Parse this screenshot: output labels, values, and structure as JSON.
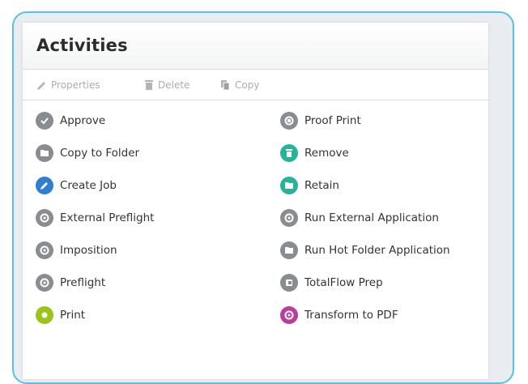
{
  "panel": {
    "title": "Activities"
  },
  "toolbar": {
    "properties_label": "Properties",
    "delete_label": "Delete",
    "copy_label": "Copy"
  },
  "activities": {
    "left": [
      {
        "label": "Approve",
        "icon": "checkmark-icon",
        "color": "#8a8d90"
      },
      {
        "label": "Copy to Folder",
        "icon": "folder-icon",
        "color": "#8a8d90"
      },
      {
        "label": "Create Job",
        "icon": "pencil-icon",
        "color": "#2f7fd0"
      },
      {
        "label": "External Preflight",
        "icon": "gear-icon",
        "color": "#8a8d90"
      },
      {
        "label": "Imposition",
        "icon": "gear-icon",
        "color": "#8a8d90"
      },
      {
        "label": "Preflight",
        "icon": "gear-icon",
        "color": "#8a8d90"
      },
      {
        "label": "Print",
        "icon": "print-icon",
        "color": "#9ac31c"
      }
    ],
    "right": [
      {
        "label": "Proof Print",
        "icon": "proof-icon",
        "color": "#8a8d90"
      },
      {
        "label": "Remove",
        "icon": "trash-icon",
        "color": "#26b39b"
      },
      {
        "label": "Retain",
        "icon": "folder-icon",
        "color": "#26b39b"
      },
      {
        "label": "Run External Application",
        "icon": "gear-icon",
        "color": "#8a8d90"
      },
      {
        "label": "Run Hot Folder Application",
        "icon": "folder-icon",
        "color": "#8a8d90"
      },
      {
        "label": "TotalFlow Prep",
        "icon": "prep-icon",
        "color": "#8a8d90"
      },
      {
        "label": "Transform to PDF",
        "icon": "transform-icon",
        "color": "#b93e9c"
      }
    ]
  }
}
